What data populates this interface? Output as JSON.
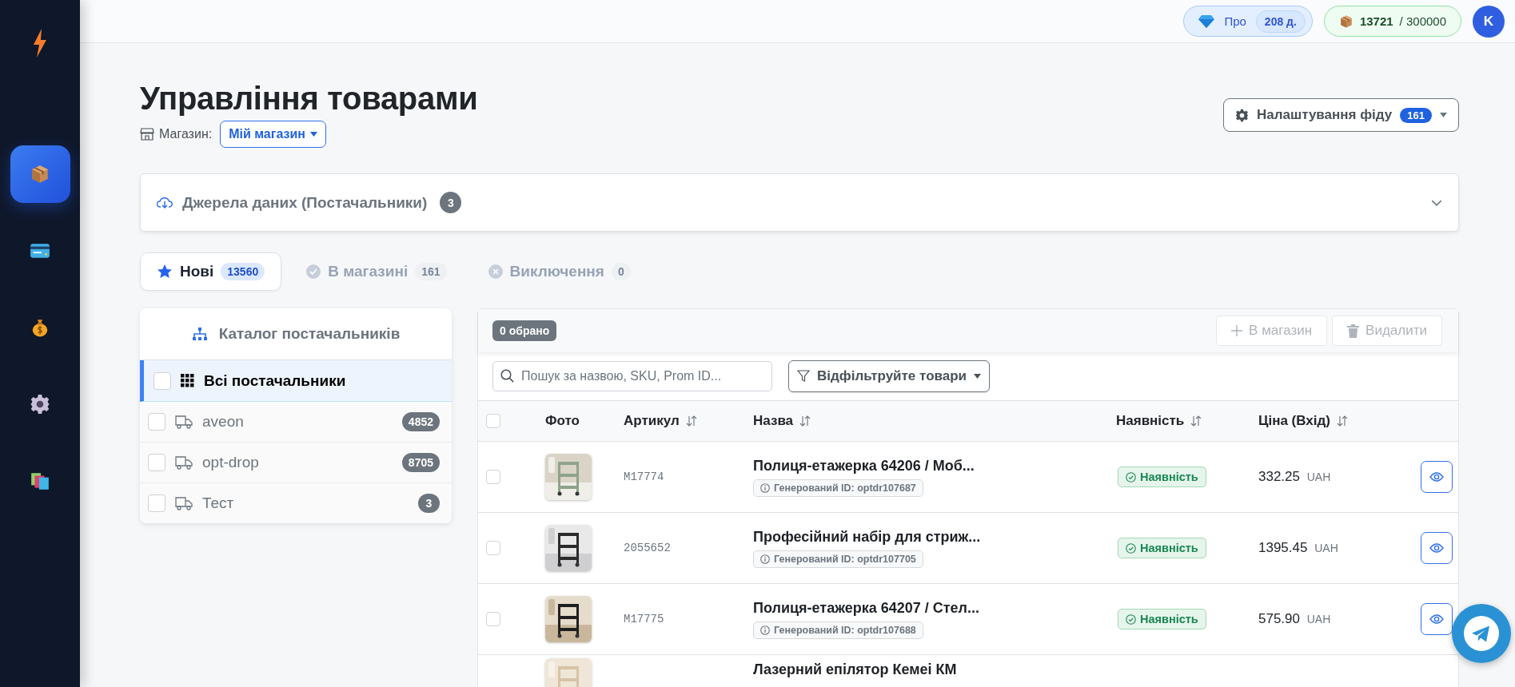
{
  "sidebar": {
    "items": [
      {
        "kind": "box",
        "selected": true
      },
      {
        "kind": "card",
        "selected": false
      },
      {
        "kind": "money",
        "selected": false
      },
      {
        "kind": "gear",
        "selected": false
      },
      {
        "kind": "books",
        "selected": false
      }
    ]
  },
  "top_bar": {
    "plan": {
      "label": "Про",
      "days": "208 д."
    },
    "quota": {
      "used": "13721",
      "limit": "/ 300000"
    },
    "avatar": "K"
  },
  "header": {
    "title": "Управління товарами",
    "store_label": "Магазин:",
    "store": "Мій магазин",
    "feed_button": {
      "label": "Налаштування фіду",
      "count": "161"
    }
  },
  "sources": {
    "title": "Джерела даних (Постачальники)",
    "count": "3",
    "expanded": false
  },
  "tabs": [
    {
      "kind": "star",
      "label": "Нові",
      "count": "13560",
      "selected": true
    },
    {
      "kind": "check",
      "label": "В магазині",
      "count": "161",
      "selected": false
    },
    {
      "kind": "cross",
      "label": "Виключення",
      "count": "0",
      "selected": false
    }
  ],
  "catalog": {
    "title": "Каталог постачальників",
    "items": [
      {
        "kind": "all",
        "label": "Всі постачальники",
        "checked": false,
        "selected": true
      },
      {
        "kind": "supplier",
        "label": "aveon",
        "count": "4852",
        "checked": false,
        "selected": false
      },
      {
        "kind": "supplier",
        "label": "opt-drop",
        "count": "8705",
        "checked": false,
        "selected": false
      },
      {
        "kind": "supplier",
        "label": "Тест",
        "count": "3",
        "checked": false,
        "selected": false
      }
    ]
  },
  "products": {
    "selected_count": "0 обрано",
    "actions": [
      {
        "kind": "add",
        "label": "В магазин",
        "disabled": true
      },
      {
        "kind": "delete",
        "label": "Видалити",
        "disabled": true
      }
    ],
    "search": {
      "placeholder": "Пошук за назвою, SKU, Prom ID..."
    },
    "filter": "Відфільтруйте товари",
    "all_checked": false,
    "columns": [
      {
        "label": "Фото",
        "sortable": false
      },
      {
        "label": "Артикул",
        "sortable": true
      },
      {
        "label": "Назва",
        "sortable": true
      },
      {
        "label": "Наявність",
        "sortable": true
      },
      {
        "label": "Ціна (Вхід)",
        "sortable": true
      }
    ],
    "rows": [
      {
        "sku": "M17774",
        "name": "Полиця-етажерка 64206 / Моб...",
        "generated_id": "Генерований ID: optdr107687",
        "availability": "Наявність",
        "in_stock": true,
        "price": "332.25",
        "currency": "UAH",
        "checked": false
      },
      {
        "sku": "2055652",
        "name": "Професійний набір для стриж...",
        "generated_id": "Генерований ID: optdr107705",
        "availability": "Наявність",
        "in_stock": true,
        "price": "1395.45",
        "currency": "UAH",
        "checked": false
      },
      {
        "sku": "M17775",
        "name": "Полиця-етажерка 64207 / Стел...",
        "generated_id": "Генерований ID: optdr107688",
        "availability": "Наявність",
        "in_stock": true,
        "price": "575.90",
        "currency": "UAH",
        "checked": false
      },
      {
        "name": "Лазерний епілятор Кемеі КМ"
      }
    ]
  }
}
